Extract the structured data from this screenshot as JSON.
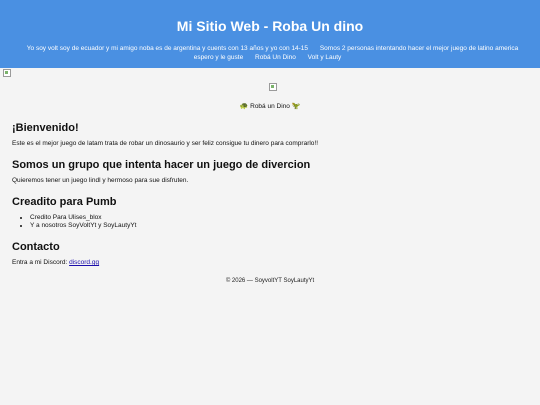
{
  "header": {
    "title": "Mi Sitio Web - Roba Un dino",
    "nav_items": [
      "Yo soy volt soy de ecuador y mi amigo noba es de argentina y cuents con 13 años y yo con 14-15",
      "Somos 2 personas intentando hacer el mejor juego de latino america espero y le guste",
      "Robá Un Dino",
      "Volt y Lauty"
    ]
  },
  "tagline": {
    "left_emoji": "🐢",
    "text": "Robá un Dino",
    "right_emoji": "🦖"
  },
  "sections": {
    "welcome": {
      "heading": "¡Bienvenido!",
      "text": "Este es el mejor juego de latam trata de robar un dinosaurio y ser feliz consigue tu dinero para comprarlo!!"
    },
    "group": {
      "heading": "Somos un grupo que intenta hacer un juego de divercion",
      "text": "Quieremos tener un juego lindl y hermoso para sue disfruten."
    },
    "credits": {
      "heading": "Creadito para Pumb",
      "items": [
        "Credito Para Ulises_blox",
        "Y a nosotros SoyVoltYt y SoyLautyYt"
      ]
    },
    "contact": {
      "heading": "Contacto",
      "text": "Entra a mi Discord:",
      "link_text": "discord.gg"
    }
  },
  "footer": {
    "text": "© 2026 — SoyvoltYT SoyLautyYt"
  }
}
